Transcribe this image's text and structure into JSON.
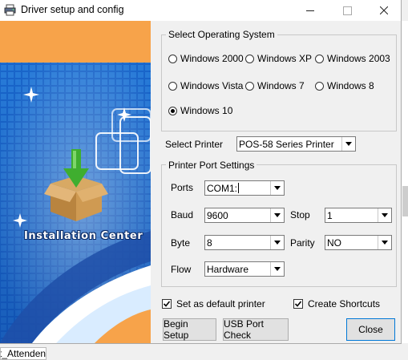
{
  "window": {
    "title": "Driver setup and config"
  },
  "banner": {
    "caption": "Installation Center"
  },
  "os": {
    "legend": "Select Operating System",
    "options": [
      "Windows 2000",
      "Windows XP",
      "Windows 2003",
      "Windows Vista",
      "Windows 7",
      "Windows 8",
      "Windows 10"
    ],
    "selected": "Windows 10"
  },
  "printer": {
    "label": "Select Printer",
    "value": "POS-58 Series Printer"
  },
  "port": {
    "legend": "Printer Port Settings",
    "ports_label": "Ports",
    "ports_value": "COM1:",
    "baud_label": "Baud",
    "baud_value": "9600",
    "stop_label": "Stop",
    "stop_value": "1",
    "byte_label": "Byte",
    "byte_value": "8",
    "parity_label": "Parity",
    "parity_value": "NO",
    "flow_label": "Flow",
    "flow_value": "Hardware"
  },
  "checks": {
    "default_printer": {
      "label": "Set as default printer",
      "checked": true
    },
    "shortcuts": {
      "label": "Create Shortcuts",
      "checked": true
    }
  },
  "buttons": {
    "begin": "Begin Setup",
    "usb": "USB Port Check",
    "close": "Close"
  },
  "background": {
    "taskbar_text": "t_Attenden"
  },
  "colors": {
    "banner_blue": "#1a63c8",
    "banner_orange": "#f7a34a",
    "default_button_border": "#0078d7"
  },
  "icons": {
    "app": "printer-app-icon",
    "minimize": "minimize-icon",
    "maximize": "maximize-icon",
    "close": "close-icon",
    "box": "box-download-icon"
  }
}
